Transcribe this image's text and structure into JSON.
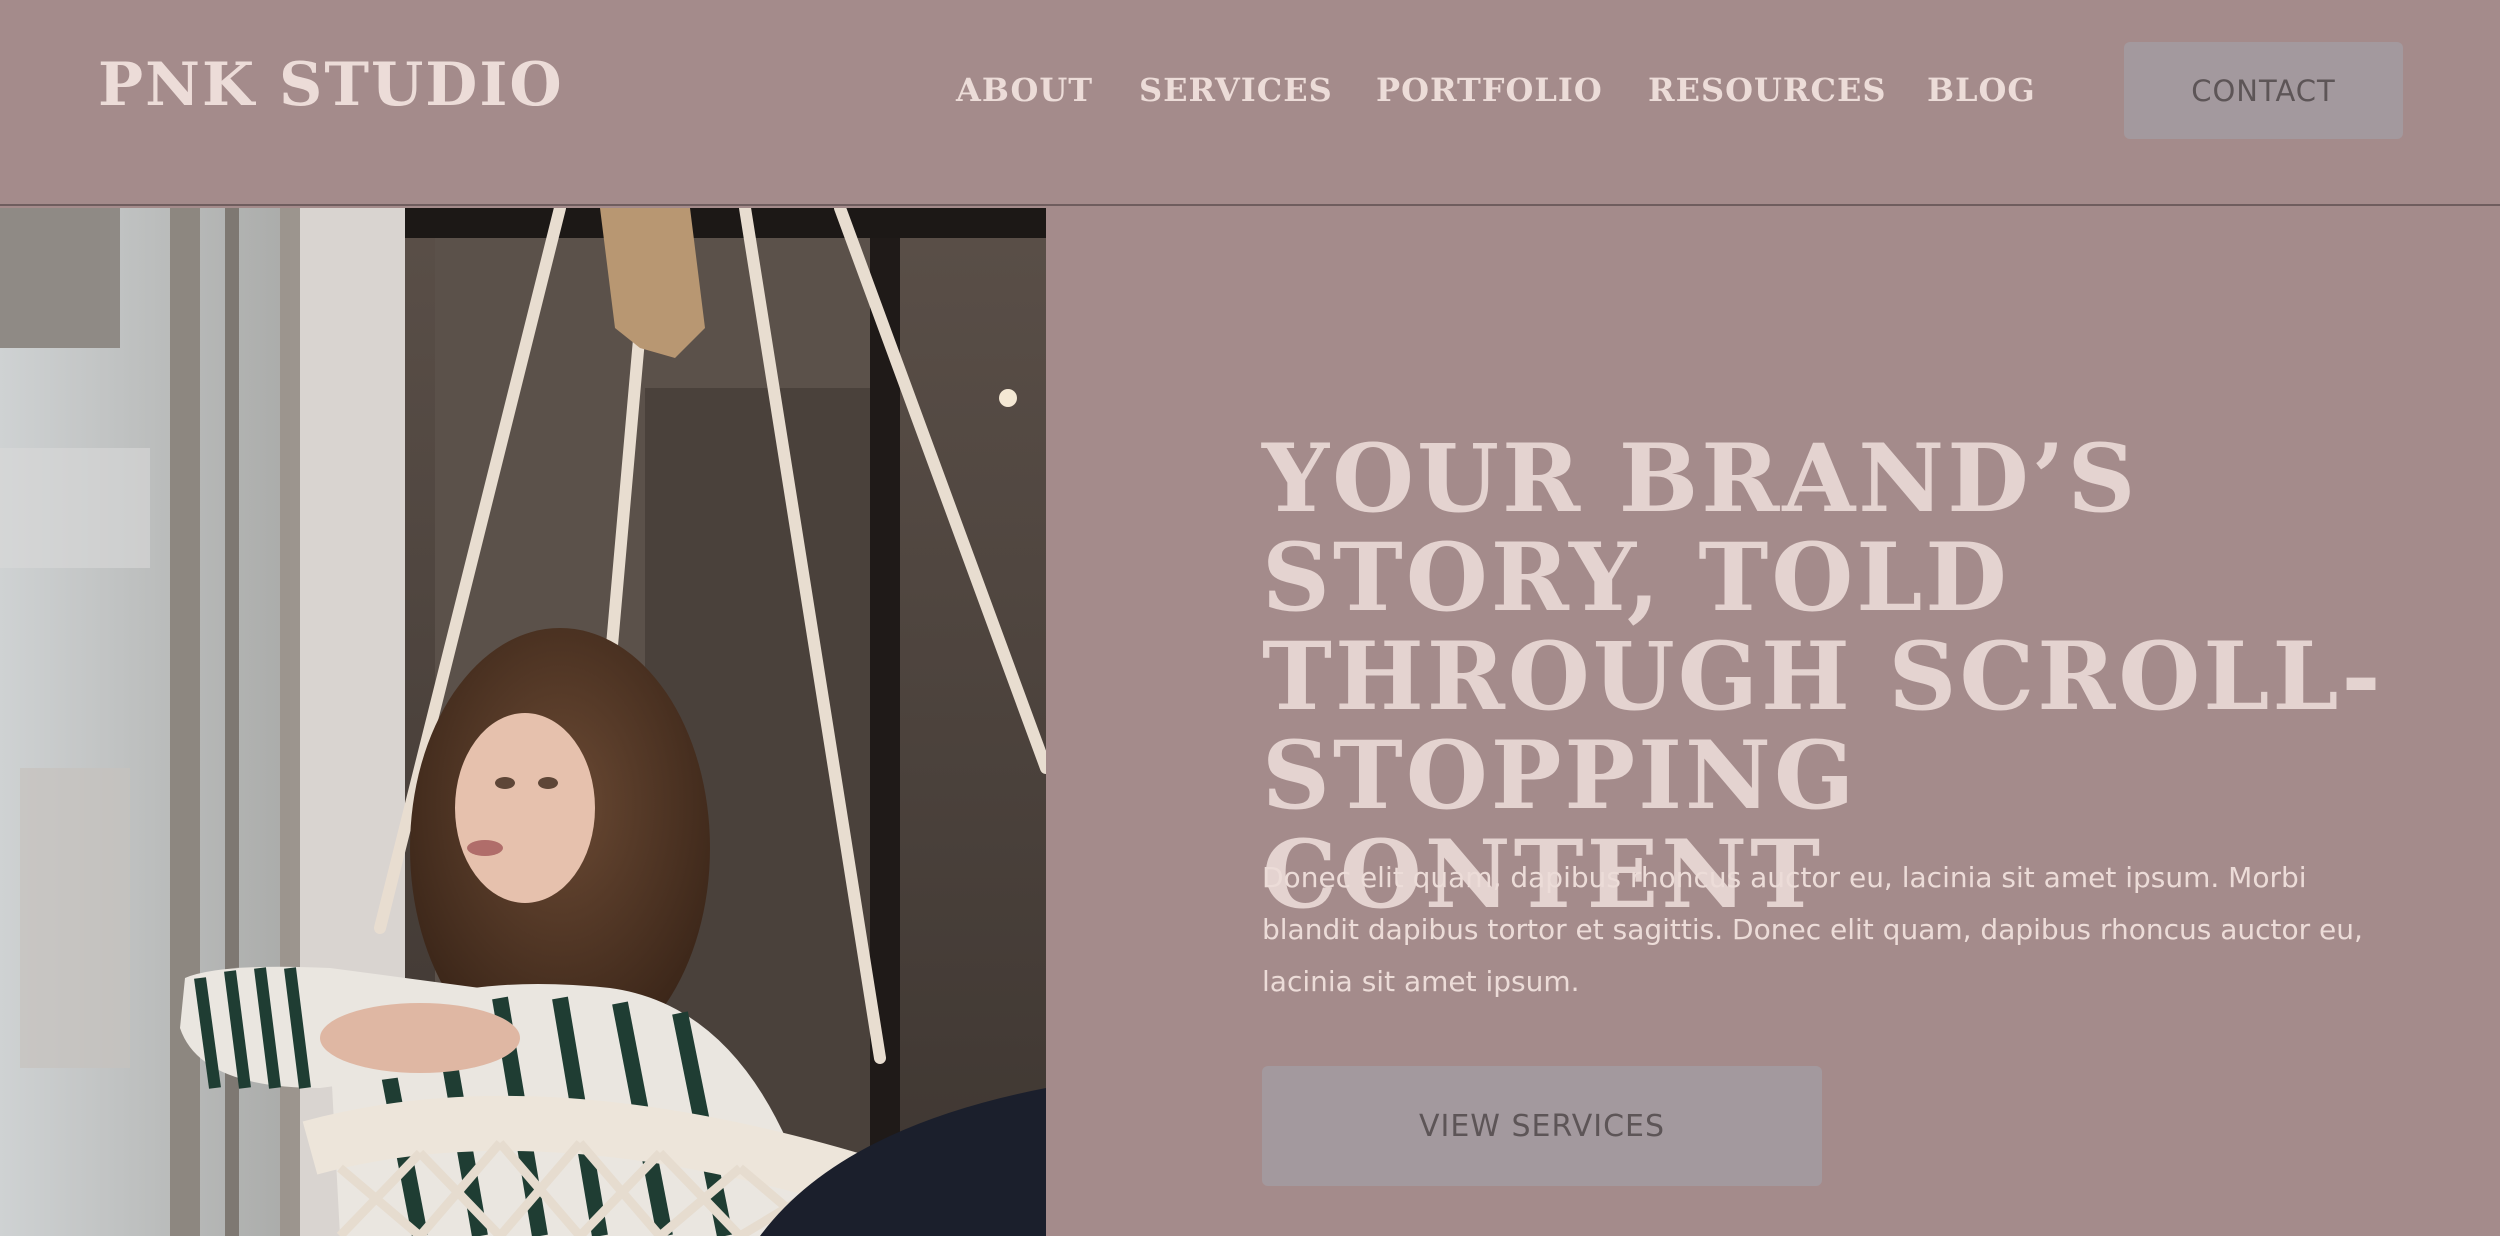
{
  "header": {
    "logo": "PNK STUDIO",
    "nav": [
      "ABOUT",
      "SERVICES",
      "PORTFOLIO",
      "RESOURCES",
      "BLOG"
    ],
    "contact_label": "CONTACT"
  },
  "hero": {
    "title": "YOUR BRAND’S STORY, TOLD THROUGH SCROLL-STOPPING CONTENT",
    "body": "Donec elit quam, dapibus rhoncus auctor eu, lacinia sit amet ipsum. Morbi blandit dapibus tortor et sagittis. Donec elit quam, dapibus rhoncus auctor eu, lacinia sit amet ipsum.",
    "cta_label": "VIEW SERVICES"
  },
  "colors": {
    "background": "#a48b8b",
    "text_light": "#ecdcd8",
    "button": "#a3999e",
    "button_text": "#5d5557"
  }
}
